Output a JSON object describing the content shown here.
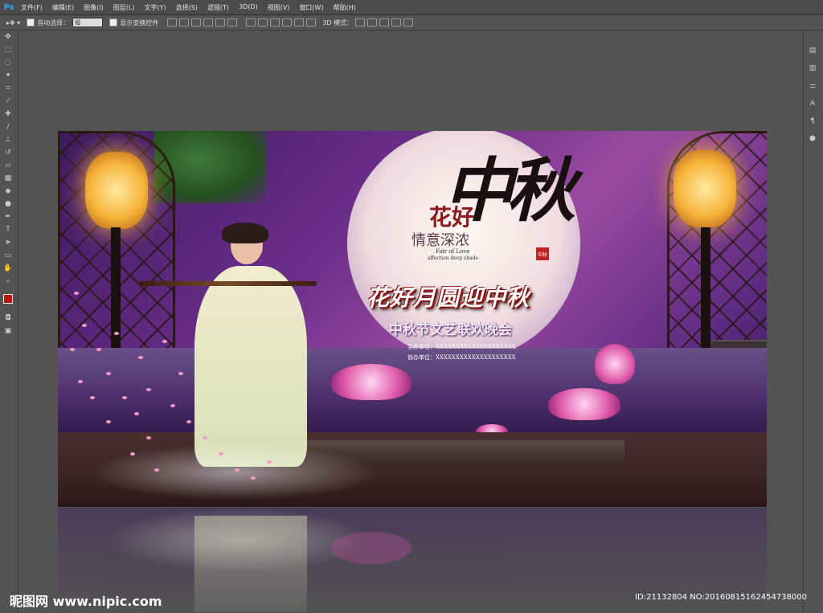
{
  "app": {
    "logo": "Ps"
  },
  "menu": [
    "文件(F)",
    "编辑(E)",
    "图像(I)",
    "图层(L)",
    "文字(Y)",
    "选择(S)",
    "滤镜(T)",
    "3D(D)",
    "视图(V)",
    "窗口(W)",
    "帮助(H)"
  ],
  "options": {
    "auto_select_label": "自动选择：",
    "auto_select_value": "组",
    "transform_label": "显示变换控件",
    "mode_label": "3D 模式："
  },
  "toolbar": [
    "move-icon",
    "marquee-icon",
    "lasso-icon",
    "magic-wand-icon",
    "crop-icon",
    "eyedropper-icon",
    "healing-icon",
    "brush-icon",
    "stamp-icon",
    "history-brush-icon",
    "eraser-icon",
    "gradient-icon",
    "blur-icon",
    "dodge-icon",
    "pen-icon",
    "type-icon",
    "path-select-icon",
    "shape-icon",
    "hand-icon",
    "zoom-icon"
  ],
  "artwork": {
    "moon_text_1": "花好",
    "moon_text_2": "情意深浓",
    "moon_small_1": "Fair of Love",
    "moon_small_2": "affection deep shade",
    "calligraphy": "中秋",
    "seal": "中秋",
    "main_title": "花好月圆迎中秋",
    "subtitle": "中秋节文艺联欢晚会",
    "host_line": "主办单位：XXXXXXXXXXXXXXXXXXXX",
    "co_host_line": "协办单位：XXXXXXXXXXXXXXXXXXXX"
  },
  "watermark": {
    "left": "昵图网 www.nipic.com",
    "right": "ID:21132804 NO:20160815162454738000"
  }
}
